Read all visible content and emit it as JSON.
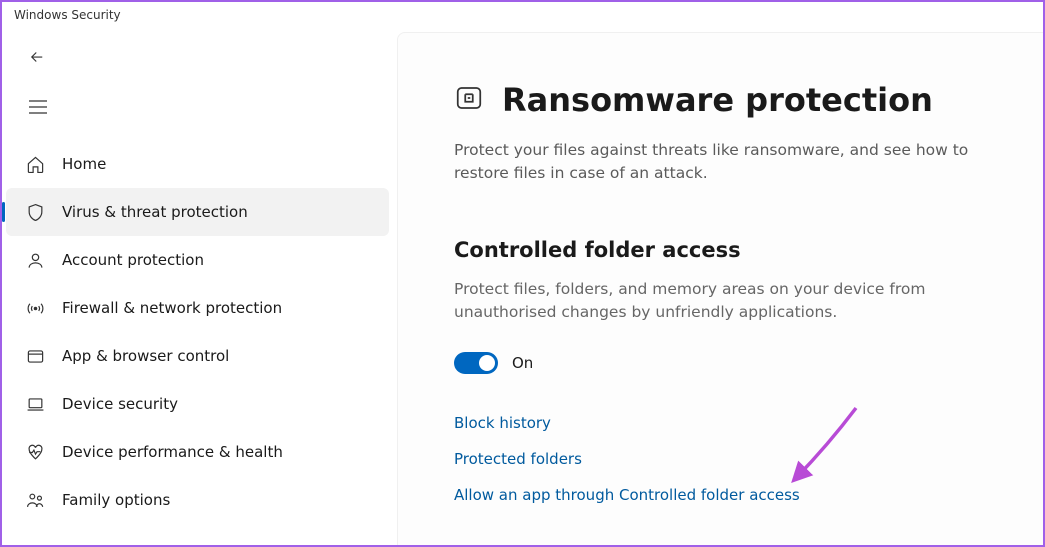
{
  "window": {
    "title": "Windows Security"
  },
  "sidebar": {
    "items": [
      {
        "label": "Home"
      },
      {
        "label": "Virus & threat protection"
      },
      {
        "label": "Account protection"
      },
      {
        "label": "Firewall & network protection"
      },
      {
        "label": "App & browser control"
      },
      {
        "label": "Device security"
      },
      {
        "label": "Device performance & health"
      },
      {
        "label": "Family options"
      }
    ]
  },
  "page": {
    "title": "Ransomware protection",
    "description": "Protect your files against threats like ransomware, and see how to restore files in case of an attack."
  },
  "section": {
    "title": "Controlled folder access",
    "description": "Protect files, folders, and memory areas on your device from unauthorised changes by unfriendly applications.",
    "toggle_state": "On"
  },
  "links": {
    "block_history": "Block history",
    "protected_folders": "Protected folders",
    "allow_app": "Allow an app through Controlled folder access"
  }
}
